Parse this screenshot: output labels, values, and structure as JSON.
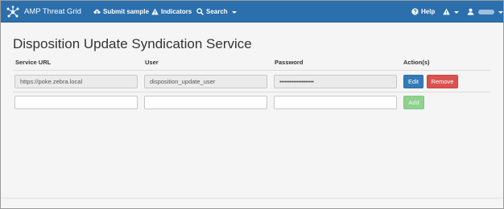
{
  "navbar": {
    "brand": "AMP Threat Grid",
    "submit_sample": "Submit sample",
    "indicators": "Indicators",
    "search": "Search",
    "help": "Help",
    "icons": {
      "brand": "threat-grid-logo",
      "submit": "cloud-upload-icon",
      "indicators": "warning-triangle-icon",
      "search": "search-icon",
      "help": "question-circle-icon",
      "alerts": "warning-triangle-icon",
      "user": "user-icon"
    }
  },
  "page": {
    "title": "Disposition Update Syndication Service"
  },
  "table": {
    "headers": [
      "Service URL",
      "User",
      "Password",
      "Action(s)"
    ],
    "rows": [
      {
        "service_url": "https://poke.zebra.local",
        "user": "disposition_update_user",
        "password": "••••••••••••••••••••",
        "actions": [
          "Edit",
          "Remove"
        ]
      }
    ],
    "new_row": {
      "service_url": "",
      "user": "",
      "password": "",
      "action": "Add"
    }
  },
  "colors": {
    "navbar": "#2c6fad",
    "edit": "#337ab7",
    "remove": "#d9534f",
    "add": "#8fd18f"
  }
}
